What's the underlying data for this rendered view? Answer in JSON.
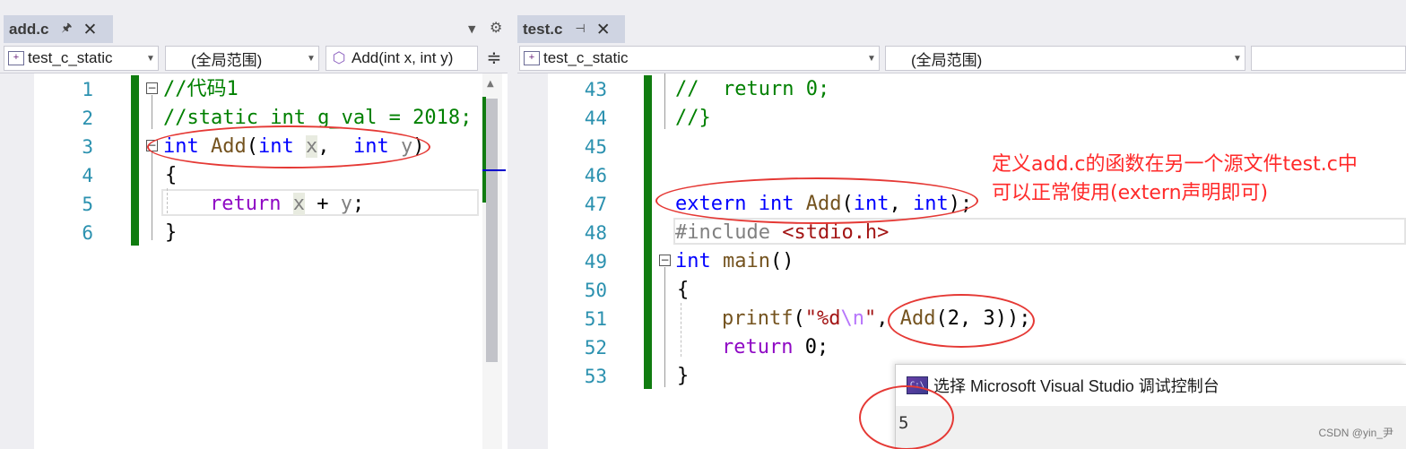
{
  "left_pane": {
    "tab": {
      "title": "add.c",
      "pin": "🖈",
      "close": "✕"
    },
    "nav": {
      "project": "test_c_static",
      "scope": "(全局范围)",
      "member": "Add(int x, int y)",
      "split_icon": "≑"
    },
    "lines": {
      "l1": {
        "num": "1",
        "comment": "//代码1"
      },
      "l2": {
        "num": "2",
        "comment": "//static int g_val = 2018;"
      },
      "l3": {
        "num": "3",
        "kw_int": "int",
        "fn_name": "Add",
        "paren_open": "(",
        "kw_int2": "int",
        "param_x": "x",
        "comma": ",",
        "kw_int3": "int",
        "param_y": "y",
        "paren_close": ")"
      },
      "l4": {
        "num": "4",
        "brace": "{"
      },
      "l5": {
        "num": "5",
        "kw_return": "return",
        "param_x": "x",
        "op": "+",
        "param_y": "y",
        "semi": ";"
      },
      "l6": {
        "num": "6",
        "brace": "}"
      }
    }
  },
  "right_pane": {
    "tab": {
      "title": "test.c",
      "pin": "⊣",
      "close": "✕"
    },
    "nav": {
      "project": "test_c_static",
      "scope": "(全局范围)"
    },
    "lines": {
      "l43": {
        "num": "43",
        "comment": "//  return 0;"
      },
      "l44": {
        "num": "44",
        "comment": "//}"
      },
      "l45": {
        "num": "45"
      },
      "l46": {
        "num": "46"
      },
      "l47": {
        "num": "47",
        "kw_extern": "extern",
        "kw_int": "int",
        "fn_name": "Add",
        "rest_a": "(",
        "kw_int2": "int",
        "rest_b": ", ",
        "kw_int3": "int",
        "rest_c": ");"
      },
      "l48": {
        "num": "48",
        "directive": "#include",
        "header": "<stdio.h>"
      },
      "l49": {
        "num": "49",
        "kw_int": "int",
        "fn_name": "main",
        "rest": "()"
      },
      "l50": {
        "num": "50",
        "brace": "{"
      },
      "l51": {
        "num": "51",
        "fn_printf": "printf",
        "paren": "(",
        "str_a": "\"%d",
        "esc": "\\n",
        "str_b": "\"",
        "comma": ", ",
        "fn_add": "Add",
        "args": "(2, 3));"
      },
      "l52": {
        "num": "52",
        "kw_return": "return",
        "rest": " 0;"
      },
      "l53": {
        "num": "53",
        "brace": "}"
      }
    }
  },
  "annotation": {
    "line1": "定义add.c的函数在另一个源文件test.c中",
    "line2": "可以正常使用(extern声明即可)"
  },
  "console": {
    "icon": "C:\\",
    "title": "选择 Microsoft Visual Studio 调试控制台",
    "output": "5"
  },
  "watermark": "CSDN @yin_尹",
  "colors": {
    "keyword": "#0000ff",
    "control_keyword": "#8f08c4",
    "function": "#74531f",
    "comment": "#008000",
    "line_number": "#2b91af",
    "change_bar": "#107c10",
    "annotation_red": "#ff2a2a"
  }
}
